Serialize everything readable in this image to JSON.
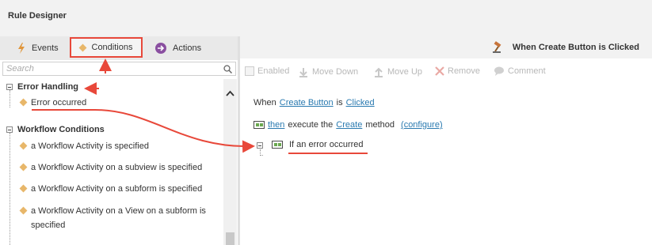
{
  "window": {
    "title": "Rule Designer"
  },
  "tabs": [
    {
      "label": "Events",
      "icon": "lightning-icon",
      "color": "#e0953a"
    },
    {
      "label": "Conditions",
      "icon": "diamond-icon",
      "color": "#e8b76a",
      "selected": true
    },
    {
      "label": "Actions",
      "icon": "arrow-circle-icon",
      "color": "#8a4fa0"
    }
  ],
  "search": {
    "placeholder": "Search"
  },
  "tree": {
    "groups": [
      {
        "label": "Error Handling",
        "items": [
          "Error occurred"
        ]
      },
      {
        "label": "Workflow Conditions",
        "items": [
          "a Workflow Activity is specified",
          "a Workflow Activity on a subview is specified",
          "a Workflow Activity on a subform is specified",
          "a Workflow Activity on a View on a subform is specified"
        ]
      }
    ]
  },
  "rule": {
    "heading": "When Create Button is Clicked",
    "toolbar": [
      "Enabled",
      "Move Down",
      "Move Up",
      "Remove",
      "Comment"
    ],
    "line1": {
      "when": "When",
      "control": "Create Button",
      "is": "is",
      "event": "Clicked"
    },
    "line2": {
      "then": "then",
      "execute": "execute the",
      "method": "Create",
      "method_word": "method",
      "configure": "(configure)"
    },
    "line3": {
      "condition": "If an error occurred"
    }
  },
  "colors": {
    "annotation": "#e8483a",
    "link": "#2a7ab0"
  }
}
